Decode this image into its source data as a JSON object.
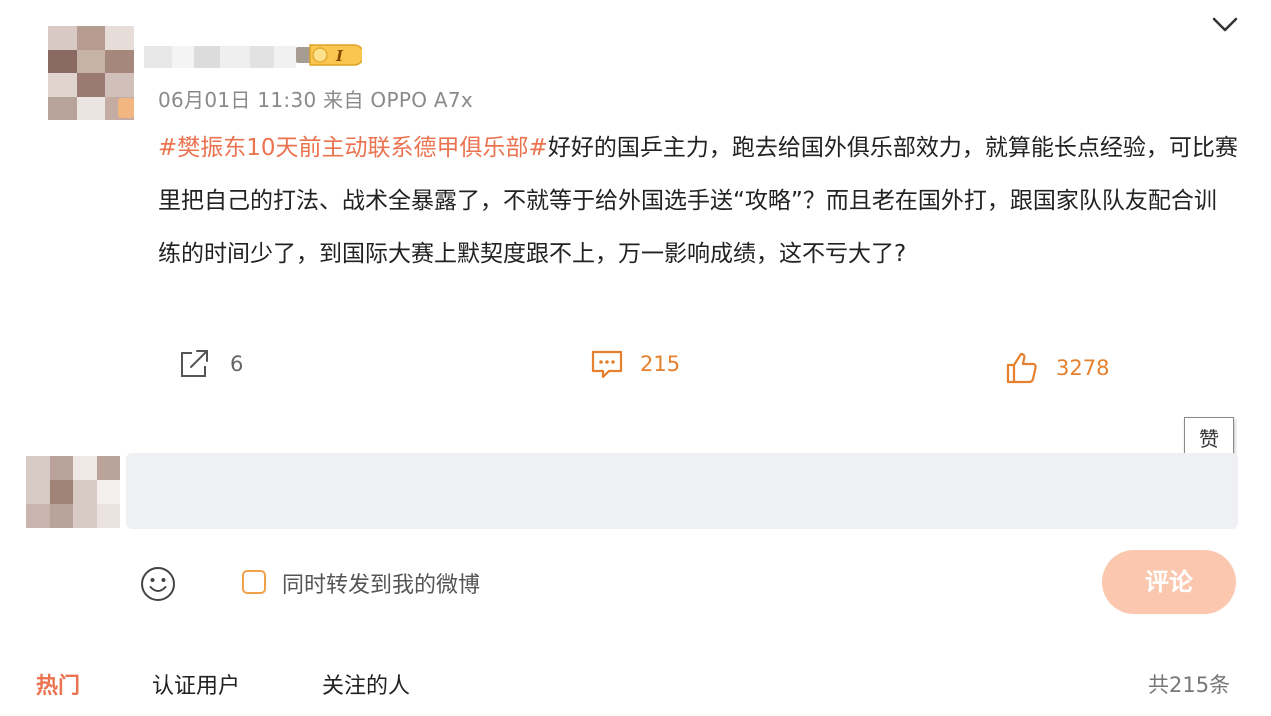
{
  "post": {
    "timestamp": "06月01日 11:30",
    "source": "来自 OPPO A7x",
    "hashtag": "#樊振东10天前主动联系德甲俱乐部#",
    "body": "好好的国乒主力，跑去给国外俱乐部效力，就算能长点经验，可比赛里把自己的打法、战术全暴露了，不就等于给外国选手送“攻略”？而且老在国外打，跟国家队队友配合训练的时间少了，到国际大赛上默契度跟不上，万一影响成绩，这不亏大了?",
    "vip_badge": "I"
  },
  "actions": {
    "forward_count": "6",
    "comment_count": "215",
    "like_count": "3278",
    "like_tooltip": "赞"
  },
  "composer": {
    "repost_label": "同时转发到我的微博",
    "submit_label": "评论"
  },
  "tabs": [
    {
      "label": "热门"
    },
    {
      "label": "认证用户"
    },
    {
      "label": "关注的人"
    }
  ],
  "total": "共215条",
  "colors": {
    "accent": "#eb7350",
    "action_orange": "#e5812e",
    "submit_bg": "#fbc7ae"
  }
}
